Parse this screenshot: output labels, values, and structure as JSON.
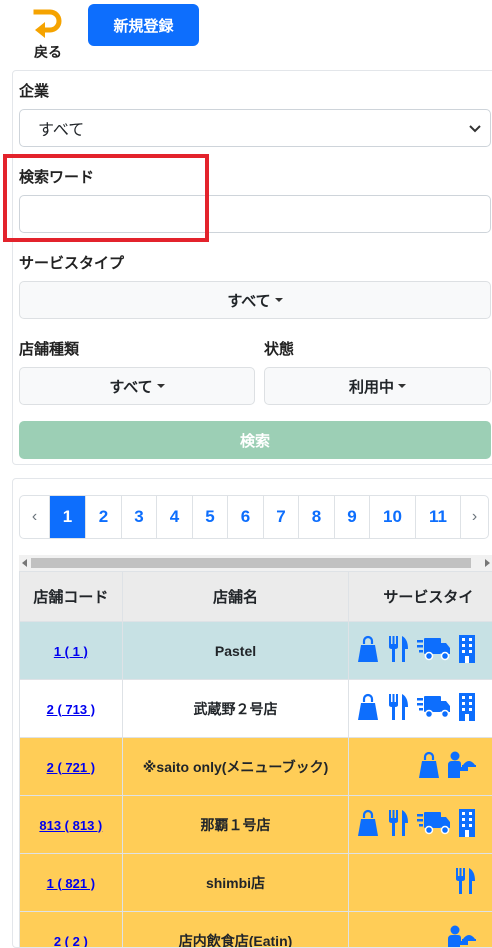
{
  "header": {
    "back_label": "戻る",
    "new_button": "新規登録"
  },
  "filters": {
    "company_label": "企業",
    "company_value": "すべて",
    "keyword_label": "検索ワード",
    "keyword_value": "",
    "service_type_label": "サービスタイプ",
    "service_type_value": "すべて",
    "store_kind_label": "店舗種類",
    "store_kind_value": "すべて",
    "status_label": "状態",
    "status_value": "利用中",
    "search_button": "検索"
  },
  "pagination": {
    "prev": "‹",
    "pages": [
      "1",
      "2",
      "3",
      "4",
      "5",
      "6",
      "7",
      "8",
      "9",
      "10",
      "11"
    ],
    "active": "1",
    "next": "›"
  },
  "table": {
    "headers": [
      "店舗コード",
      "店舗名",
      "サービスタイ"
    ],
    "rows": [
      {
        "code": "1 ( 1 )",
        "name": "Pastel",
        "style": "blue",
        "icons": [
          "takeout-bag-icon",
          "fork-knife-icon",
          "delivery-truck-icon",
          "building-icon"
        ]
      },
      {
        "code": "2 ( 713 )",
        "name": "武蔵野２号店",
        "style": "white",
        "icons": [
          "takeout-bag-icon",
          "fork-knife-icon",
          "delivery-truck-icon",
          "building-icon"
        ]
      },
      {
        "code": "2 ( 721 )",
        "name": "※saito only(メニューブック)",
        "style": "yellow",
        "icons": [
          "takeout-bag-icon",
          "waiter-icon"
        ]
      },
      {
        "code": "813 ( 813 )",
        "name": "那覇１号店",
        "style": "yellow",
        "icons": [
          "takeout-bag-icon",
          "fork-knife-icon",
          "delivery-truck-icon",
          "building-icon"
        ]
      },
      {
        "code": "1 ( 821 )",
        "name": "shimbi店",
        "style": "yellow",
        "icons": [
          "fork-knife-icon"
        ]
      },
      {
        "code": "2 ( 2 )",
        "name": "店内飲食店(Eatin)",
        "style": "yellow",
        "icons": [
          "waiter-icon"
        ]
      }
    ]
  },
  "colors": {
    "primary": "#0d6efd",
    "search_button": "#9ccfb5",
    "highlight_box": "#e3232c",
    "icon": "#0d6efd",
    "back_icon": "#f5a300",
    "row_blue": "#c7e1e4",
    "row_yellow": "#ffcd57"
  }
}
